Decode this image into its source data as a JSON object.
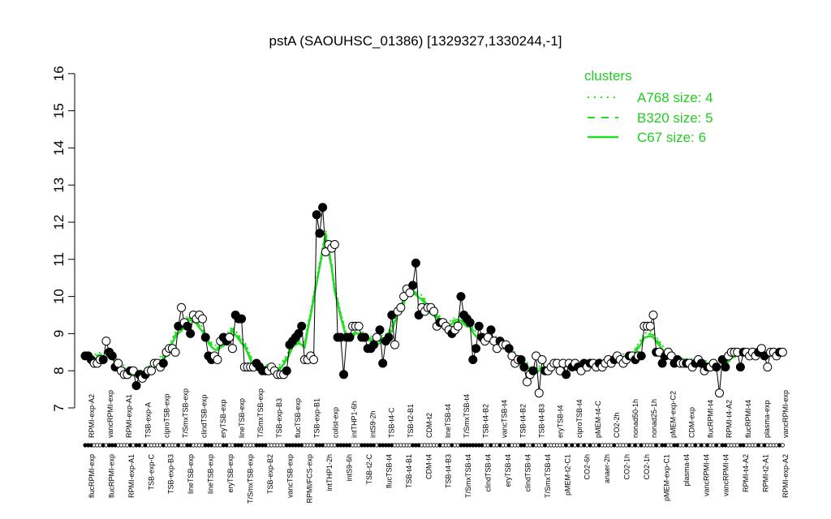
{
  "chart_data": {
    "type": "line",
    "title": "pstA (SAOUHSC_01386) [1329327,1330244,-1]",
    "xlabel": "",
    "ylabel": "",
    "ylim": [
      7,
      16
    ],
    "yticks": [
      7,
      8,
      9,
      10,
      11,
      12,
      13,
      14,
      15,
      16
    ],
    "grid": false,
    "legend": {
      "title": "clusters",
      "placement": "top-right",
      "entries": [
        {
          "label": "A768 size: 4",
          "style": "dotted"
        },
        {
          "label": "B320 size: 5",
          "style": "dashed"
        },
        {
          "label": "C67 size: 6",
          "style": "solid"
        }
      ]
    },
    "colors": {
      "cluster_line": "#22dd22",
      "axis": "#000000",
      "point_filled": "#000000",
      "point_open": "#ffffff"
    },
    "top_labels": [
      "RPMI-exp-A2",
      "vancRPMI-exp",
      "RPMI-exp-A1",
      "TSB-exp-A",
      "ciproTSB-exp",
      "T/SmxTSB-exp",
      "clindTSB-exp",
      "eryTSB-exp",
      "lineTSB-exp",
      "T/SmxTSB-exp",
      "TSB-exp-B3",
      "flucTSB-exp",
      "TSB-exp-B1",
      "colist-exp",
      "intTHP1-6h",
      "intS9-2h",
      "TSB-t4-C",
      "TSB-t2-B1",
      "CDM-t2",
      "lineTSB-t4",
      "T/SmxTSB-t4",
      "TSB-t4-B2",
      "vancTSB-t4",
      "TSB-t4-B2",
      "TSB-t4-B3",
      "eryTSB-t4",
      "ciproTSB-t4",
      "pMEM-t4-C",
      "CO2-2h",
      "nonad50-1h",
      "nonad25-1h",
      "pMEM-exp-C2",
      "CDM-exp",
      "flucRPMI-t4",
      "RPMI-t4-A2",
      "flucRPMI-t4",
      "plasma-exp",
      "vancRPMI-exp"
    ],
    "bottom_labels": [
      "flucRPMI-exp",
      "flucRPMI-exp",
      "RPMI-exp-A1",
      "TSB-exp-C",
      "TSB-exp-B3",
      "lineTSB-exp",
      "lineTSB-exp",
      "eryTSB-exp",
      "T/SmxTSB-exp",
      "TSB-exp-B2",
      "vancTSB-exp",
      "RPMI/FCS-exp",
      "intTHP1-2h",
      "intS9-6h",
      "TSB-t2-C",
      "flucTSB-t4",
      "TSB-t4-B1",
      "CDM-t4",
      "TSB-t4-B3",
      "T/SmxTSB-t4",
      "clindTSB-t4",
      "eryTSB-t4",
      "clindTSB-t4",
      "T/SmxTSB-t4",
      "pMEM-t2-C1",
      "CO2-6h",
      "anaer-2h",
      "CO2-1h",
      "CO2-1h",
      "pMEM-exp-C1",
      "plasma-t4",
      "vancRPMI-t4",
      "vancRPMI-t4",
      "RPMI-t4-A2",
      "RPMI-t2-A1",
      "RPMI-exp-A2"
    ],
    "x": [
      1,
      2,
      3,
      4,
      5,
      6,
      7,
      8,
      9,
      10,
      11,
      12,
      13,
      14,
      15,
      16,
      17,
      18,
      19,
      20,
      21,
      22,
      23,
      24,
      25,
      26,
      27,
      28,
      29,
      30,
      31,
      32,
      33,
      34,
      35,
      36,
      37,
      38,
      39,
      40,
      41,
      42,
      43,
      44,
      45,
      46,
      47,
      48,
      49,
      50,
      51,
      52,
      53,
      54,
      55,
      56,
      57,
      58,
      59,
      60,
      61,
      62,
      63,
      64,
      65,
      66,
      67,
      68,
      69,
      70,
      71,
      72,
      73,
      74,
      75,
      76,
      77,
      78,
      79,
      80,
      81,
      82,
      83,
      84,
      85,
      86,
      87,
      88,
      89,
      90,
      91,
      92,
      93,
      94,
      95,
      96,
      97,
      98,
      99,
      100,
      101,
      102,
      103,
      104,
      105,
      106,
      107,
      108,
      109,
      110,
      111,
      112,
      113,
      114,
      115,
      116,
      117,
      118,
      119,
      120,
      121,
      122,
      123,
      124,
      125,
      126,
      127,
      128,
      129,
      130,
      131,
      132,
      133,
      134,
      135,
      136,
      137,
      138,
      139,
      140,
      141,
      142,
      143,
      144,
      145,
      146,
      147,
      148,
      149,
      150,
      151,
      152,
      153,
      154,
      155,
      156,
      157,
      158,
      159,
      160,
      161,
      162,
      163,
      164,
      165,
      166,
      167,
      168,
      169,
      170,
      171,
      172,
      173,
      174,
      175,
      176,
      177,
      178,
      179,
      180,
      181,
      182,
      183,
      184,
      185,
      186,
      187,
      188,
      189,
      190,
      191,
      192,
      193,
      194,
      195,
      196,
      197,
      198,
      199,
      200,
      201,
      202,
      203,
      204,
      205,
      206,
      207,
      208,
      209,
      210,
      211,
      212,
      213,
      214,
      215,
      216,
      217,
      218,
      219,
      220,
      221,
      222,
      223,
      224,
      225,
      226,
      227,
      228,
      229,
      230,
      231,
      232,
      233,
      234
    ],
    "series": [
      {
        "values": [
          8.4,
          8.4,
          8.3,
          8.2,
          8.2,
          8.3,
          8.3,
          8.8,
          8.5,
          8.4,
          8.1,
          8.2,
          8.0,
          7.9,
          7.9,
          8.0,
          8.0,
          7.6,
          7.9,
          7.8,
          7.9,
          8.0,
          8.0,
          8.2,
          8.2,
          8.1,
          8.2,
          8.5,
          8.6,
          8.6,
          8.5,
          9.2,
          9.7,
          9.3,
          9.2,
          9.0,
          9.5,
          9.4,
          9.5,
          9.4,
          8.9,
          8.4,
          8.3,
          8.4,
          8.3,
          8.8,
          8.9,
          8.8,
          8.9,
          8.6,
          9.5,
          9.4,
          9.4,
          8.1,
          8.1,
          8.1,
          8.1,
          8.2,
          8.1,
          8.0,
          8.0,
          8.0,
          8.1,
          8.0,
          7.9,
          7.9,
          7.9,
          8.0,
          8.7,
          8.8,
          8.9,
          9.0,
          9.2,
          8.3,
          8.3,
          8.4,
          8.3,
          12.2,
          11.7,
          12.4,
          11.2,
          11.4,
          11.3,
          11.4,
          8.9,
          8.9,
          7.9,
          8.9,
          8.9,
          9.2,
          9.2,
          9.2,
          8.9,
          8.9,
          8.6,
          8.6,
          8.7,
          8.9,
          9.1,
          8.2,
          8.8,
          8.9,
          9.5,
          8.7,
          9.6,
          9.7,
          10.0,
          10.2,
          10.1,
          10.3,
          10.9,
          9.5,
          9.7,
          9.6,
          9.7,
          9.7,
          9.6,
          9.2,
          9.3,
          9.3,
          9.2,
          9.1,
          9.0,
          9.1,
          9.2,
          10.0,
          9.5,
          9.4,
          9.3,
          8.3,
          8.6,
          9.2,
          8.9,
          8.8,
          8.9,
          9.1,
          8.8,
          8.6,
          8.8,
          8.7,
          8.7,
          8.6,
          8.4,
          8.2,
          8.3,
          8.3,
          8.1,
          7.7,
          7.9,
          8.0,
          8.4,
          7.4,
          8.3,
          8.0,
          8.0,
          8.1,
          8.2,
          8.2,
          8.0,
          8.2,
          7.9,
          8.2,
          8.1,
          8.2,
          8.1,
          8.0,
          8.2,
          8.1,
          8.2,
          8.2,
          8.1,
          8.2,
          8.1,
          8.2,
          8.3,
          8.2,
          8.3,
          8.4,
          8.3,
          8.2,
          8.3,
          8.4,
          8.4,
          8.3,
          8.4,
          8.4,
          9.2,
          9.2,
          9.2,
          9.5,
          8.5,
          8.5,
          8.2,
          8.4,
          8.5,
          8.4,
          8.2,
          8.3,
          8.2,
          8.2,
          8.2,
          8.2,
          8.1,
          8.2,
          8.3,
          8.2,
          8.0,
          8.1,
          8.1,
          8.2,
          8.1,
          7.4,
          8.3,
          8.1,
          8.4,
          8.5,
          8.5,
          8.5,
          8.1,
          8.5,
          8.5,
          8.4,
          8.5,
          8.4,
          8.5,
          8.6,
          8.4,
          8.1,
          8.5,
          8.5,
          8.4,
          8.5,
          8.5
        ],
        "filled": [
          1,
          1,
          1,
          0,
          0,
          0,
          1,
          0,
          1,
          1,
          1,
          0,
          0,
          0,
          0,
          1,
          0,
          1,
          1,
          0,
          1,
          0,
          0,
          0,
          0,
          0,
          1,
          0,
          0,
          0,
          0,
          1,
          0,
          0,
          1,
          1,
          0,
          0,
          0,
          0,
          1,
          1,
          1,
          0,
          0,
          0,
          1,
          1,
          0,
          0,
          1,
          1,
          1,
          0,
          0,
          0,
          0,
          1,
          1,
          1,
          1,
          0,
          0,
          0,
          0,
          0,
          0,
          1,
          1,
          1,
          1,
          1,
          1,
          0,
          0,
          0,
          0,
          1,
          1,
          1,
          0,
          0,
          0,
          0,
          1,
          1,
          1,
          1,
          1,
          0,
          0,
          0,
          1,
          1,
          1,
          1,
          1,
          0,
          1,
          1,
          1,
          1,
          1,
          0,
          0,
          0,
          0,
          0,
          0,
          1,
          1,
          1,
          0,
          0,
          0,
          0,
          0,
          0,
          1,
          0,
          0,
          0,
          1,
          0,
          0,
          1,
          1,
          1,
          1,
          1,
          1,
          1,
          1,
          0,
          0,
          1,
          0,
          0,
          1,
          0,
          0,
          1,
          0,
          0,
          0,
          1,
          1,
          0,
          0,
          1,
          0,
          0,
          0,
          1,
          0,
          0,
          0,
          0,
          0,
          0,
          1,
          0,
          1,
          0,
          1,
          0,
          1,
          0,
          1,
          0,
          0,
          1,
          0,
          0,
          0,
          0,
          1,
          0,
          0,
          0,
          0,
          1,
          0,
          1,
          0,
          1,
          0,
          0,
          0,
          0,
          1,
          0,
          1,
          1,
          0,
          0,
          1,
          1,
          0,
          0,
          1,
          0,
          0,
          1,
          0,
          1,
          0,
          1,
          0,
          0,
          1,
          0,
          1,
          1,
          0,
          0,
          0,
          0,
          1,
          1,
          0,
          0,
          0,
          0,
          1,
          0,
          1,
          0,
          0,
          0,
          0,
          1,
          0
        ]
      }
    ]
  }
}
